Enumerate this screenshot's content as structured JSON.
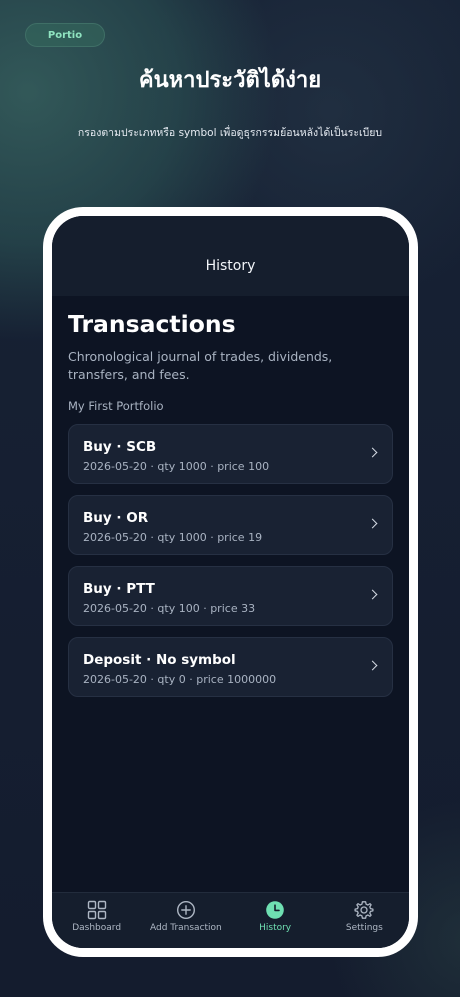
{
  "brand": {
    "label": "Portio"
  },
  "hero": {
    "title": "ค้นหาประวัติได้ง่าย",
    "subtitle": "กรองตามประเภทหรือ symbol เพื่อดูธุรกรรมย้อนหลังได้เป็นระเบียบ"
  },
  "screen": {
    "nav_title": "History",
    "title": "Transactions",
    "description": "Chronological journal of trades, dividends, transfers, and fees.",
    "portfolio": "My First Portfolio",
    "transactions": [
      {
        "title": "Buy · SCB",
        "meta": "2026-05-20 · qty 1000 · price 100"
      },
      {
        "title": "Buy · OR",
        "meta": "2026-05-20 · qty 1000 · price 19"
      },
      {
        "title": "Buy · PTT",
        "meta": "2026-05-20 · qty 100 · price 33"
      },
      {
        "title": "Deposit · No symbol",
        "meta": "2026-05-20 · qty 0 · price 1000000"
      }
    ]
  },
  "tabs": [
    {
      "label": "Dashboard",
      "icon": "grid-icon",
      "active": false
    },
    {
      "label": "Add Transaction",
      "icon": "plus-circle-icon",
      "active": false
    },
    {
      "label": "History",
      "icon": "clock-icon",
      "active": true
    },
    {
      "label": "Settings",
      "icon": "gear-icon",
      "active": false
    }
  ],
  "colors": {
    "accent": "#6fe0b2",
    "background": "#162033",
    "card": "#192233"
  }
}
